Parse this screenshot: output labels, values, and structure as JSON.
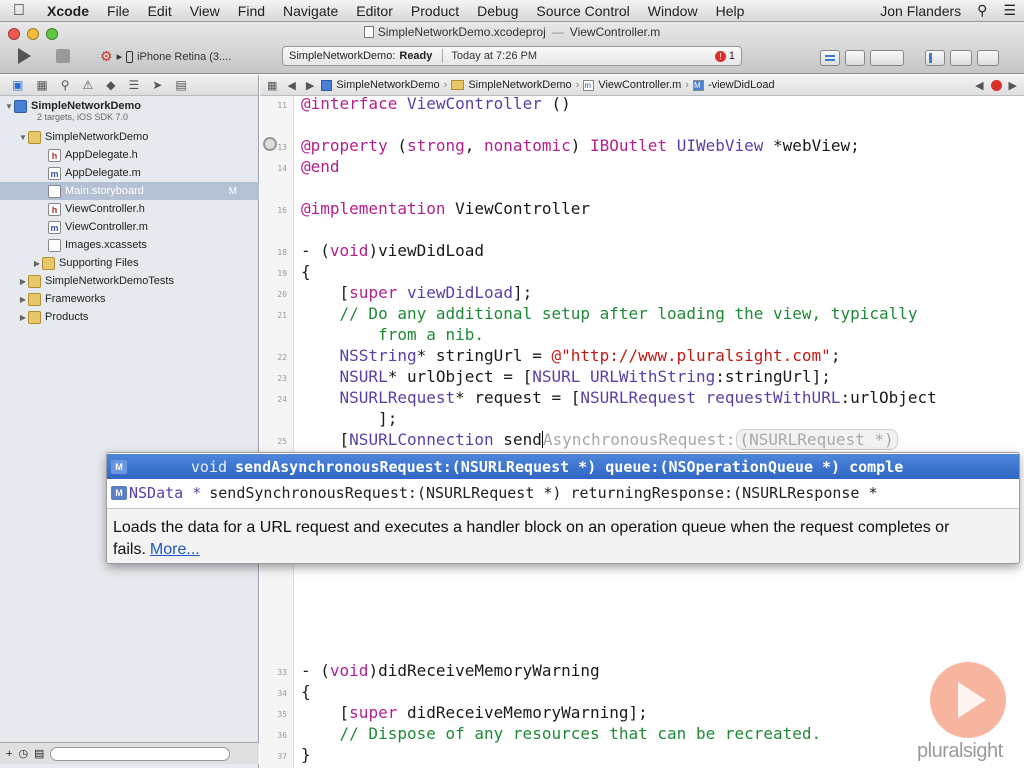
{
  "menubar": {
    "app": "Xcode",
    "items": [
      "File",
      "Edit",
      "View",
      "Find",
      "Navigate",
      "Editor",
      "Product",
      "Debug",
      "Source Control",
      "Window",
      "Help"
    ],
    "user": "Jon Flanders"
  },
  "window": {
    "title": "SimpleNetworkDemo.xcodeproj",
    "file": "ViewController.m"
  },
  "toolbar": {
    "scheme_device": "iPhone Retina (3....",
    "status_project": "SimpleNetworkDemo:",
    "status_state": "Ready",
    "status_time": "Today at 7:26 PM",
    "issue_count": "1"
  },
  "navigator": {
    "items": [
      {
        "label": "SimpleNetworkDemo",
        "kind": "project"
      },
      {
        "label": "SimpleNetworkDemo",
        "kind": "folder"
      },
      {
        "label": "AppDelegate.h",
        "kind": "h"
      },
      {
        "label": "AppDelegate.m",
        "kind": "m"
      },
      {
        "label": "Main.storyboard",
        "kind": "storyboard",
        "badge": "M"
      },
      {
        "label": "ViewController.h",
        "kind": "h"
      },
      {
        "label": "ViewController.m",
        "kind": "m"
      },
      {
        "label": "Images.xcassets",
        "kind": "xcassets"
      },
      {
        "label": "Supporting Files",
        "kind": "folder"
      },
      {
        "label": "SimpleNetworkDemoTests",
        "kind": "folder"
      },
      {
        "label": "Frameworks",
        "kind": "folder"
      },
      {
        "label": "Products",
        "kind": "folder"
      }
    ],
    "project_subtitle": "2 targets, iOS SDK 7.0"
  },
  "jumpbar": {
    "crumbs": [
      "SimpleNetworkDemo",
      "SimpleNetworkDemo",
      "ViewController.m",
      "-viewDidLoad"
    ]
  },
  "editor": {
    "line_numbers": [
      "11",
      "13",
      "14",
      "16",
      "18",
      "19",
      "20",
      "21",
      "22",
      "23",
      "24",
      "25",
      "33",
      "34",
      "35",
      "36",
      "37"
    ]
  },
  "completion": {
    "row1": {
      "tag": "M",
      "return_type": "void",
      "signature": "sendAsynchronousRequest:(NSURLRequest *) queue:(NSOperationQueue *) comple"
    },
    "row2": {
      "tag": "M",
      "return_type": "NSData *",
      "signature": "sendSynchronousRequest:(NSURLRequest *) returningResponse:(NSURLResponse *"
    },
    "doc": "Loads the data for a URL request and executes a handler block on an operation queue when the request completes or fails.",
    "more": "More..."
  },
  "watermark": {
    "logo": "pluralsight"
  }
}
